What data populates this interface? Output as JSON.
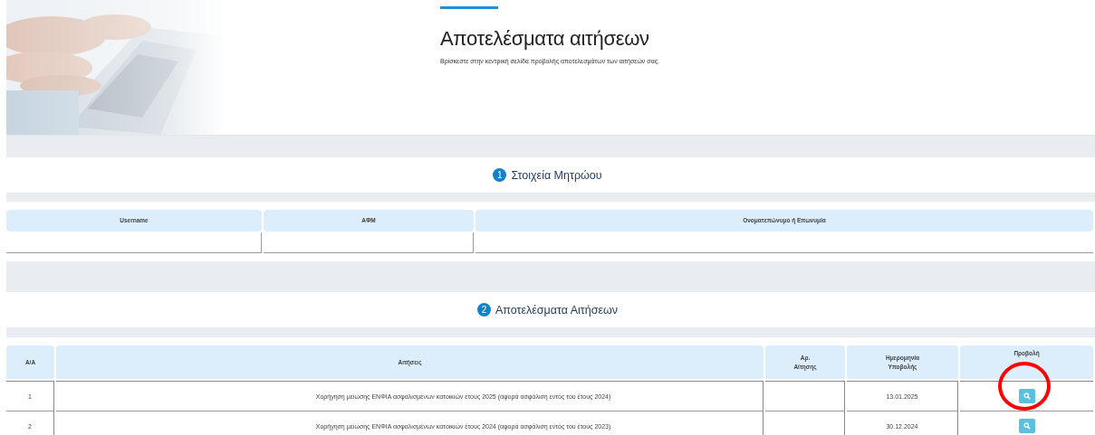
{
  "header": {
    "title": "Αποτελέσματα αιτήσεων",
    "subtitle": "Βρίσκεστε στην κεντρική σελίδα προβολής αποτελεσμάτων των αιτήσεών σας."
  },
  "registry": {
    "step": "1",
    "heading": "Στοιχεία Μητρώου",
    "columns": [
      "Username",
      "ΑΦΜ",
      "Ονοματεπώνυμο ή Επωνυμία"
    ]
  },
  "results": {
    "step": "2",
    "heading": "Αποτελέσματα Αιτήσεων",
    "columns": [
      "Α/Α",
      "Αιτήσεις",
      "Αρ.\nΑίτησης",
      "Ημερομηνία\nΥποβολής",
      "Προβολή"
    ],
    "rows": [
      {
        "index": "1",
        "application": "Χορήγηση μείωσης ΕΝΦΙΑ ασφαλισμένων κατοικιών έτους 2025 (αφορά ασφάλιση εντός του έτους 2024)",
        "date": "13.01.2025",
        "highlighted": true
      },
      {
        "index": "2",
        "application": "Χορήγηση μείωσης ΕΝΦΙΑ ασφαλισμένων κατοικιών έτους 2024 (αφορά ασφάλιση εντός του έτους 2023)",
        "date": "30.12.2024",
        "highlighted": false
      }
    ]
  }
}
